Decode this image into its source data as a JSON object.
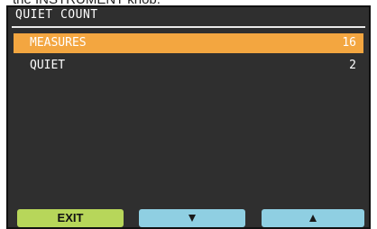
{
  "caption": "the INSTRUMENT knob.",
  "screen": {
    "title": "QUIET COUNT",
    "rows": [
      {
        "label": "MEASURES",
        "value": "16",
        "selected": true
      },
      {
        "label": "QUIET",
        "value": "2",
        "selected": false
      }
    ]
  },
  "softkeys": {
    "exit": "EXIT",
    "down_icon": "down-arrow-icon",
    "up_icon": "up-arrow-icon"
  },
  "colors": {
    "screen_bg": "#2f2f2f",
    "selection": "#f3a640",
    "exit_key": "#b7d65a",
    "arrow_keys": "#8fcfe2"
  }
}
